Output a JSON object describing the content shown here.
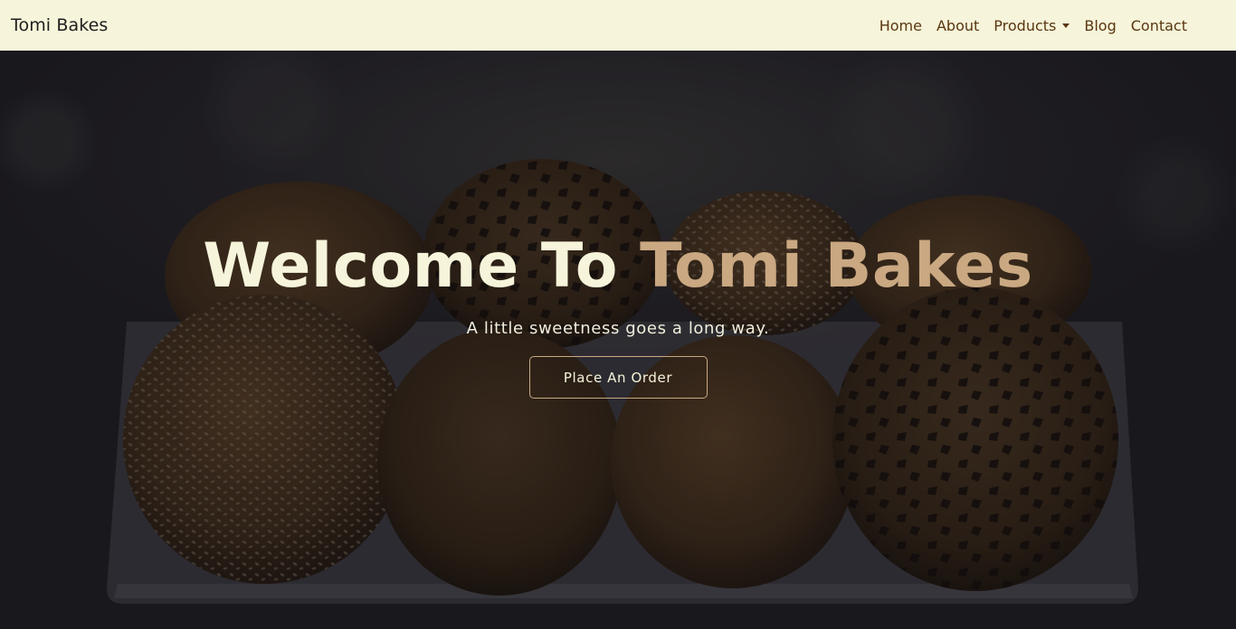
{
  "navbar": {
    "brand": "Tomi Bakes",
    "links": {
      "home": "Home",
      "about": "About",
      "products": "Products",
      "blog": "Blog",
      "contact": "Contact"
    }
  },
  "hero": {
    "title_part1": "Welcome To",
    "title_part2": "Tomi Bakes",
    "subtitle": "A little sweetness goes a long way.",
    "cta_label": "Place An Order"
  },
  "colors": {
    "navbar_bg": "#f6f4da",
    "nav_link": "#5a3610",
    "accent": "#c9a882",
    "hero_text": "#f6f4da"
  },
  "icons": {
    "products_dropdown": "caret-down-icon"
  }
}
